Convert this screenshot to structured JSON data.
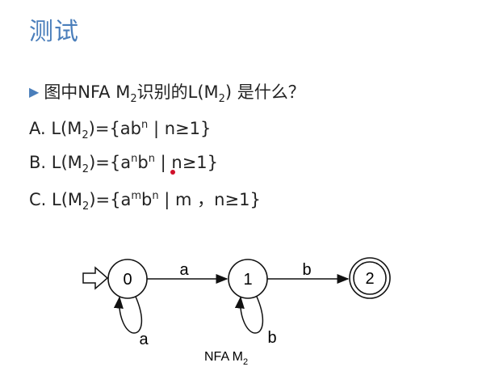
{
  "title": "测试",
  "question": {
    "prefix": "图中NFA M",
    "sub": "2",
    "middle": "识别的L(M",
    "sub2": "2",
    "suffix": ") 是什么？"
  },
  "options": [
    {
      "label": "A.",
      "lm": "L(M",
      "sub": "2",
      "eq": ")={ab",
      "sup": "n",
      "rest": " | n≥1}"
    },
    {
      "label": "B.",
      "lm": "L(M",
      "sub": "2",
      "eq": ")={a",
      "sup": "n",
      "mid": "b",
      "sup2": "n",
      "rest": " | n≥1}"
    },
    {
      "label": "C.",
      "lm": "L(M",
      "sub": "2",
      "eq": ")={a",
      "sup": "m",
      "mid": "b",
      "sup2": "n",
      "rest": " | m ，n≥1}"
    }
  ],
  "diagram": {
    "states": [
      "0",
      "1",
      "2"
    ],
    "edge_labels": {
      "s0_s1": "a",
      "s1_s2": "b",
      "loop0": "a",
      "loop1": "b"
    },
    "caption": "NFA M",
    "caption_sub": "2",
    "accepting_state": "2",
    "start_state": "0"
  }
}
